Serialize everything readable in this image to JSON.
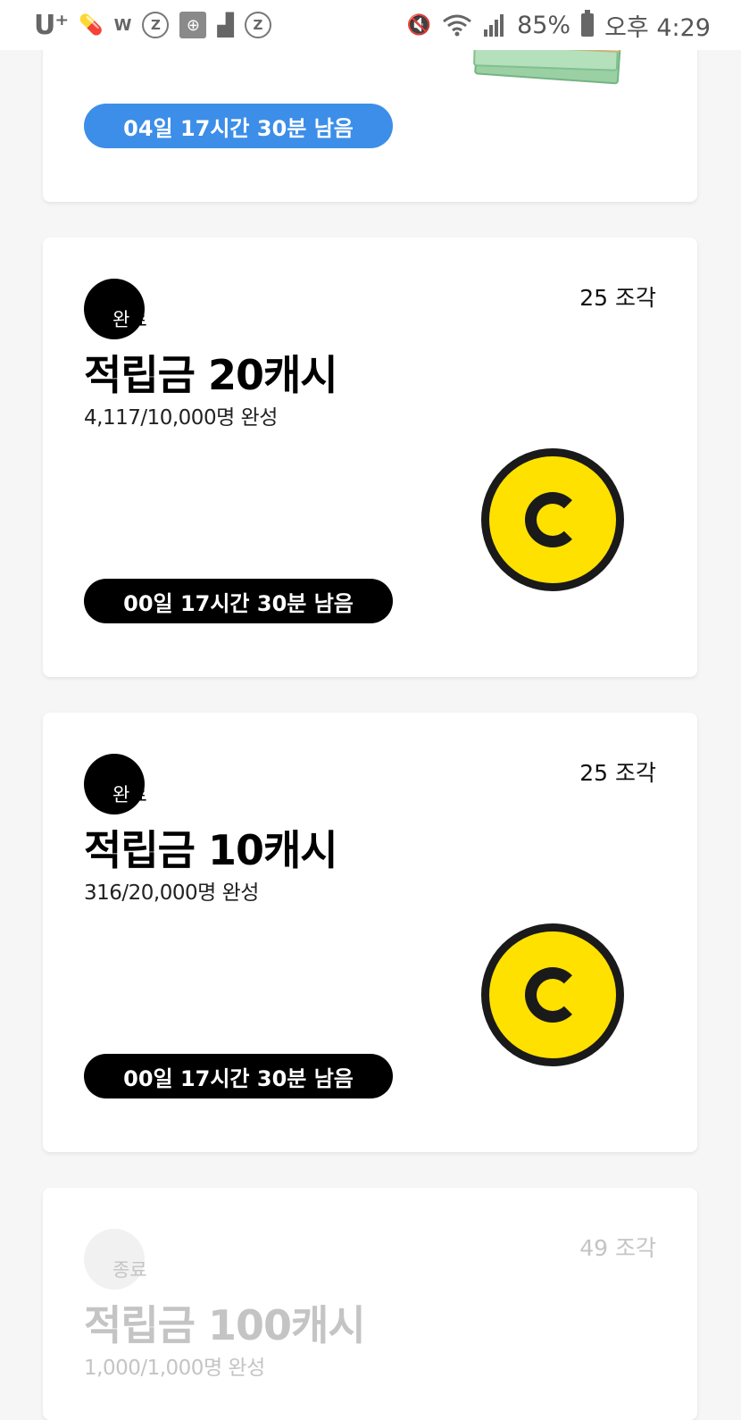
{
  "status_bar": {
    "carrier": "U⁺",
    "battery_percent": "85%",
    "time": "오후 4:29"
  },
  "cards": [
    {
      "timer": "04일 17시간 30분 남음",
      "timer_color": "#3c8ee8",
      "image": "cash-bills"
    },
    {
      "badge": "완료",
      "pieces": "25 조각",
      "title": "적립금 20캐시",
      "count": "4,117/10,000명 완성",
      "timer": "00일 17시간 30분 남음",
      "image": "coin-icon"
    },
    {
      "badge": "완료",
      "pieces": "25 조각",
      "title": "적립금 10캐시",
      "count": "316/20,000명 완성",
      "timer": "00일 17시간 30분 남음",
      "image": "coin-icon"
    },
    {
      "badge": "종료",
      "pieces": "49 조각",
      "title": "적립금 100캐시",
      "count": "1,000/1,000명 완성"
    }
  ],
  "colors": {
    "accent_blue": "#3c8ee8",
    "coin_yellow": "#ffe100",
    "faded_text": "#c4c4c4"
  }
}
